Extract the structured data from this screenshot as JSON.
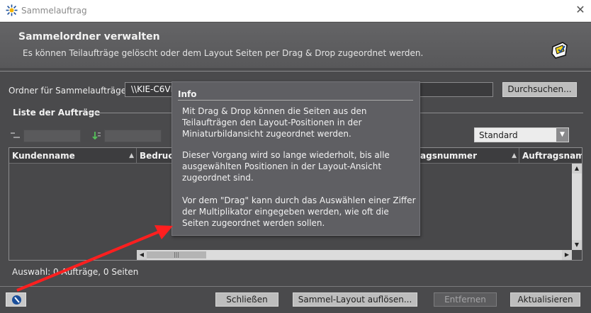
{
  "window": {
    "title": "Sammelauftrag",
    "close_glyph": "✕"
  },
  "header": {
    "title": "Sammelordner verwalten",
    "subtitle": "Es können Teilaufträge gelöscht oder dem Layout Seiten per Drag & Drop zugeordnet werden."
  },
  "folder": {
    "label": "Ordner für Sammelaufträge:",
    "value": "\\\\KIE-C6VP",
    "browse_label": "Durchsuchen..."
  },
  "orders": {
    "group_title": "Liste der Aufträge",
    "view_select": "Standard",
    "columns": [
      {
        "label": "Kundenname"
      },
      {
        "label": "Bedruck"
      },
      {
        "label": "agsnummer"
      },
      {
        "label": "Auftragsnam"
      }
    ],
    "status": "Auswahl:  0 Aufträge,   0 Seiten"
  },
  "tooltip": {
    "title": "Info",
    "paragraphs": [
      "Mit Drag & Drop können die Seiten aus den Teilaufträgen den Layout-Positionen in der Miniaturbildansicht zugeordnet werden.",
      "Dieser Vorgang wird so lange wiederholt, bis alle ausgewählten Positionen in der Layout-Ansicht zugeordnet sind.",
      "Vor dem \"Drag\" kann durch das Auswählen einer Ziffer der Multiplikator eingegeben werden, wie oft die Seiten zugeordnet werden sollen."
    ]
  },
  "buttons": {
    "close": "Schließen",
    "dissolve": "Sammel-Layout auflösen...",
    "remove": "Entfernen",
    "refresh": "Aktualisieren"
  },
  "colors": {
    "panel": "#4a4a4c",
    "header": "#5e5e60",
    "tooltip": "#5f5f63",
    "arrow": "#ff1f1f"
  }
}
